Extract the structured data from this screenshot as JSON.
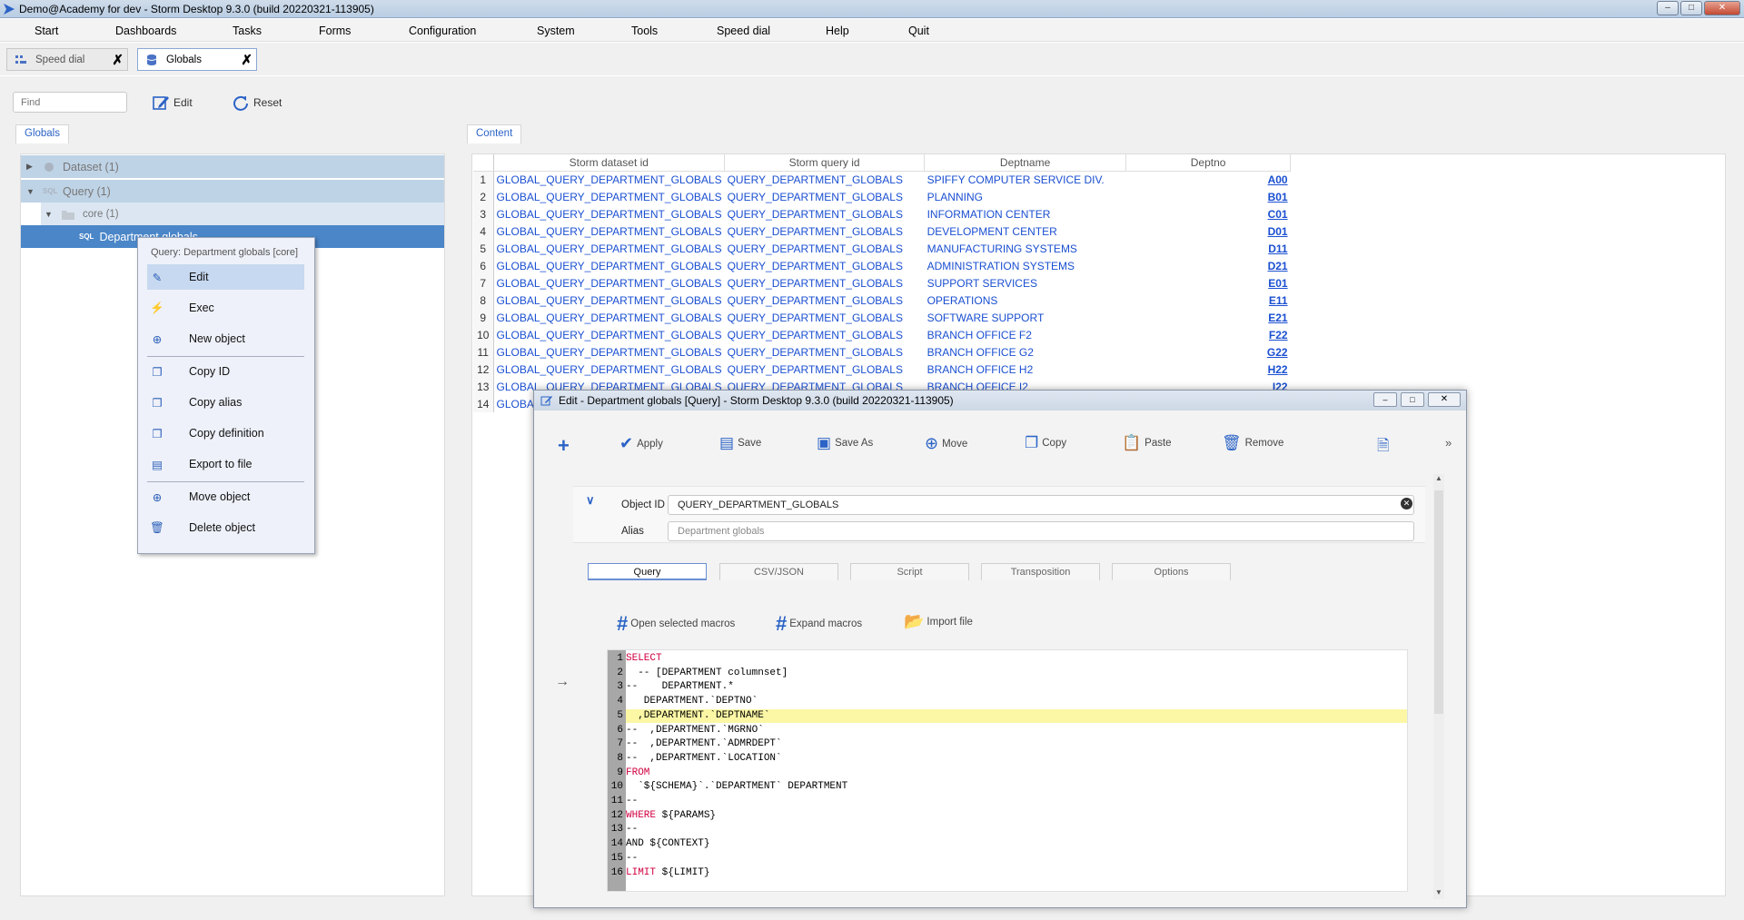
{
  "window": {
    "title": "Demo@Academy for dev -  Storm Desktop 9.3.0 (build 20220321-113905)"
  },
  "menu": [
    "Start",
    "Dashboards",
    "Tasks",
    "Forms",
    "Configuration",
    "System",
    "Tools",
    "Speed dial",
    "Help",
    "Quit"
  ],
  "doc_tabs": [
    {
      "label": "Speed dial",
      "active": false
    },
    {
      "label": "Globals",
      "active": true
    }
  ],
  "toolbar": {
    "find_placeholder": "Find",
    "edit": "Edit",
    "reset": "Reset"
  },
  "tree": {
    "tab": "Globals",
    "rows": [
      {
        "label": "Dataset (1)",
        "icon": "dataset-icon"
      },
      {
        "label": "Query (1)",
        "icon": "sql-icon"
      },
      {
        "label": "core (1)",
        "icon": "folder-icon"
      },
      {
        "label": "Department globals",
        "icon": "sql-icon"
      }
    ]
  },
  "context_menu": {
    "header": "Query: Department globals [core]",
    "items": [
      "Edit",
      "Exec",
      "New object",
      "Copy ID",
      "Copy alias",
      "Copy definition",
      "Export to file",
      "Move object",
      "Delete object"
    ]
  },
  "content": {
    "tab": "Content",
    "columns": [
      "Storm dataset id",
      "Storm query id",
      "Deptname",
      "Deptno"
    ],
    "rows": [
      [
        "1",
        "GLOBAL_QUERY_DEPARTMENT_GLOBALS",
        "QUERY_DEPARTMENT_GLOBALS",
        "SPIFFY COMPUTER SERVICE DIV.",
        "A00"
      ],
      [
        "2",
        "GLOBAL_QUERY_DEPARTMENT_GLOBALS",
        "QUERY_DEPARTMENT_GLOBALS",
        "PLANNING",
        "B01"
      ],
      [
        "3",
        "GLOBAL_QUERY_DEPARTMENT_GLOBALS",
        "QUERY_DEPARTMENT_GLOBALS",
        "INFORMATION CENTER",
        "C01"
      ],
      [
        "4",
        "GLOBAL_QUERY_DEPARTMENT_GLOBALS",
        "QUERY_DEPARTMENT_GLOBALS",
        "DEVELOPMENT CENTER",
        "D01"
      ],
      [
        "5",
        "GLOBAL_QUERY_DEPARTMENT_GLOBALS",
        "QUERY_DEPARTMENT_GLOBALS",
        "MANUFACTURING SYSTEMS",
        "D11"
      ],
      [
        "6",
        "GLOBAL_QUERY_DEPARTMENT_GLOBALS",
        "QUERY_DEPARTMENT_GLOBALS",
        "ADMINISTRATION SYSTEMS",
        "D21"
      ],
      [
        "7",
        "GLOBAL_QUERY_DEPARTMENT_GLOBALS",
        "QUERY_DEPARTMENT_GLOBALS",
        "SUPPORT SERVICES",
        "E01"
      ],
      [
        "8",
        "GLOBAL_QUERY_DEPARTMENT_GLOBALS",
        "QUERY_DEPARTMENT_GLOBALS",
        "OPERATIONS",
        "E11"
      ],
      [
        "9",
        "GLOBAL_QUERY_DEPARTMENT_GLOBALS",
        "QUERY_DEPARTMENT_GLOBALS",
        "SOFTWARE SUPPORT",
        "E21"
      ],
      [
        "10",
        "GLOBAL_QUERY_DEPARTMENT_GLOBALS",
        "QUERY_DEPARTMENT_GLOBALS",
        "BRANCH OFFICE F2",
        "F22"
      ],
      [
        "11",
        "GLOBAL_QUERY_DEPARTMENT_GLOBALS",
        "QUERY_DEPARTMENT_GLOBALS",
        "BRANCH OFFICE G2",
        "G22"
      ],
      [
        "12",
        "GLOBAL_QUERY_DEPARTMENT_GLOBALS",
        "QUERY_DEPARTMENT_GLOBALS",
        "BRANCH OFFICE H2",
        "H22"
      ],
      [
        "13",
        "GLOBAL_QUERY_DEPARTMENT_GLOBALS",
        "QUERY_DEPARTMENT_GLOBALS",
        "BRANCH OFFICE I2",
        "I22"
      ],
      [
        "14",
        "GLOBAL",
        "",
        "",
        ""
      ]
    ]
  },
  "dialog": {
    "title": "Edit - Department globals [Query] -  Storm Desktop 9.3.0 (build 20220321-113905)",
    "toolbar": [
      "Apply",
      "Save",
      "Save As",
      "Move",
      "Copy",
      "Paste",
      "Remove"
    ],
    "object_id_label": "Object ID",
    "object_id_value": "QUERY_DEPARTMENT_GLOBALS",
    "alias_label": "Alias",
    "alias_value": "Department globals",
    "tabs": [
      "Query",
      "CSV/JSON",
      "Script",
      "Transposition",
      "Options"
    ],
    "macro_buttons": [
      "Open selected macros",
      "Expand macros",
      "Import file"
    ],
    "code": [
      "SELECT",
      "  -- [DEPARTMENT columnset]",
      "--    DEPARTMENT.*",
      "   DEPARTMENT.`DEPTNO`",
      "  ,DEPARTMENT.`DEPTNAME`",
      "--  ,DEPARTMENT.`MGRNO`",
      "--  ,DEPARTMENT.`ADMRDEPT`",
      "--  ,DEPARTMENT.`LOCATION`",
      "FROM",
      "  `${SCHEMA}`.`DEPARTMENT` DEPARTMENT",
      "--",
      "WHERE ${PARAMS}",
      "--",
      "AND ${CONTEXT}",
      "--",
      "LIMIT ${LIMIT}"
    ]
  },
  "colors": {
    "accent": "#2b63c6",
    "link": "#1a4fd1",
    "keyword": "#d00040",
    "highlight": "#fbf7a5",
    "selection": "#4a86c8"
  }
}
